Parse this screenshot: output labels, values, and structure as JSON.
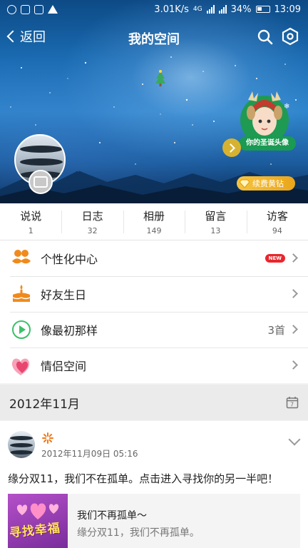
{
  "status_bar": {
    "network_speed": "3.01K/s",
    "network_type": "4G",
    "battery": "34%",
    "time": "13:09"
  },
  "header": {
    "back_label": "返回",
    "title": "我的空间"
  },
  "festive_banner": {
    "label": "你的圣诞头像"
  },
  "vip_badge": {
    "label": "续费黄钻"
  },
  "stats": [
    {
      "label": "说说",
      "count": "1"
    },
    {
      "label": "日志",
      "count": "32"
    },
    {
      "label": "相册",
      "count": "149"
    },
    {
      "label": "留言",
      "count": "13"
    },
    {
      "label": "访客",
      "count": "94"
    }
  ],
  "menu": [
    {
      "label": "个性化中心",
      "badge": "NEW",
      "icon": "mustache-icon"
    },
    {
      "label": "好友生日",
      "icon": "birthday-cake-icon"
    },
    {
      "label": "像最初那样",
      "value": "3首",
      "icon": "play-icon"
    },
    {
      "label": "情侣空间",
      "icon": "heart-icon"
    }
  ],
  "month_bar": {
    "label": "2012年11月"
  },
  "post": {
    "timestamp": "2012年11月09日 05:16",
    "text": "缘分双11，我们不在孤单。点击进入寻找你的另一半吧！",
    "share": {
      "thumb_text": "寻找幸福",
      "title": "我们不再孤单～",
      "description": "缘分双11，我们不再孤单。"
    }
  },
  "colors": {
    "accent_orange": "#f08a1c",
    "new_badge": "#e8262d",
    "vip_gold": "#f0b530"
  }
}
